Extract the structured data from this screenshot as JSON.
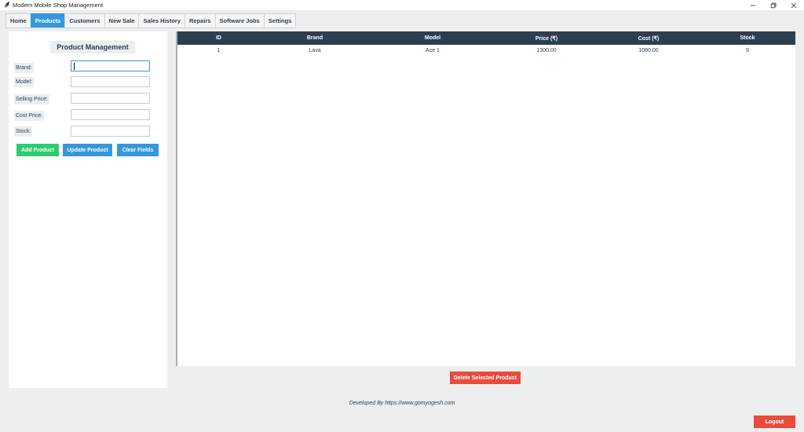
{
  "window": {
    "title": "Modern Mobile Shop Management",
    "icon": "feather-icon",
    "controls": [
      "minimize-icon",
      "restore-icon",
      "close-icon"
    ]
  },
  "tabs": [
    {
      "label": "Home",
      "active": false
    },
    {
      "label": "Products",
      "active": true
    },
    {
      "label": "Customers",
      "active": false
    },
    {
      "label": "New Sale",
      "active": false
    },
    {
      "label": "Sales History",
      "active": false
    },
    {
      "label": "Repairs",
      "active": false
    },
    {
      "label": "Software Jobs",
      "active": false
    },
    {
      "label": "Settings",
      "active": false
    }
  ],
  "form": {
    "title": "Product Management",
    "fields": [
      {
        "label": "Brand:",
        "value": ""
      },
      {
        "label": "Model:",
        "value": ""
      },
      {
        "label": "Selling Price:",
        "value": ""
      },
      {
        "label": "Cost Price:",
        "value": ""
      },
      {
        "label": "Stock:",
        "value": ""
      }
    ],
    "buttons": {
      "add": "Add Product",
      "update": "Update Product",
      "clear": "Clear Fields"
    }
  },
  "table": {
    "columns": [
      "ID",
      "Brand",
      "Model",
      "Price (₹)",
      "Cost (₹)",
      "Stock"
    ],
    "rows": [
      [
        "1",
        "Lava",
        "Ace 1",
        "1300.00",
        "1080.00",
        "9"
      ]
    ]
  },
  "actions": {
    "delete": "Delete Selected Product",
    "logout": "Logout"
  },
  "footer": {
    "text": "Developed By https://www.gomyogesh.com"
  },
  "colors": {
    "accent": "#3498db",
    "success": "#2ecc71",
    "danger": "#e74c3c",
    "header": "#2c3e50",
    "background": "#eceeef"
  }
}
